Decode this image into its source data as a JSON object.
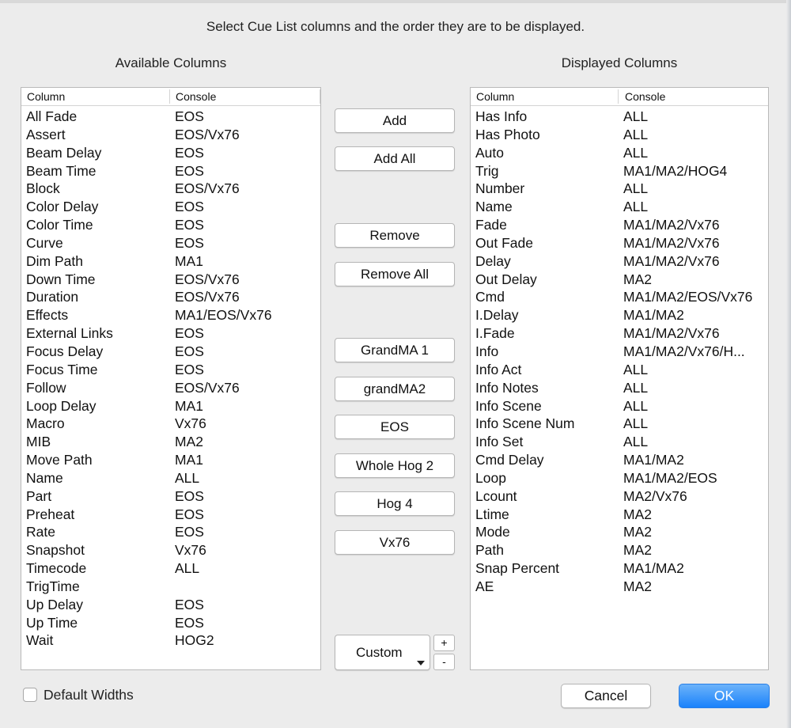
{
  "dialog": {
    "instruction": "Select Cue List columns and the order they are to be displayed."
  },
  "available": {
    "title": "Available Columns",
    "headers": [
      "Column",
      "Console"
    ],
    "rows": [
      [
        "All Fade",
        "EOS"
      ],
      [
        "Assert",
        "EOS/Vx76"
      ],
      [
        "Beam Delay",
        "EOS"
      ],
      [
        "Beam Time",
        "EOS"
      ],
      [
        "Block",
        "EOS/Vx76"
      ],
      [
        "Color Delay",
        "EOS"
      ],
      [
        "Color Time",
        "EOS"
      ],
      [
        "Curve",
        "EOS"
      ],
      [
        "Dim Path",
        "MA1"
      ],
      [
        "Down Time",
        "EOS/Vx76"
      ],
      [
        "Duration",
        "EOS/Vx76"
      ],
      [
        "Effects",
        "MA1/EOS/Vx76"
      ],
      [
        "External Links",
        "EOS"
      ],
      [
        "Focus Delay",
        "EOS"
      ],
      [
        "Focus Time",
        "EOS"
      ],
      [
        "Follow",
        "EOS/Vx76"
      ],
      [
        "Loop Delay",
        "MA1"
      ],
      [
        "Macro",
        "Vx76"
      ],
      [
        "MIB",
        "MA2"
      ],
      [
        "Move Path",
        "MA1"
      ],
      [
        "Name",
        "ALL"
      ],
      [
        "Part",
        "EOS"
      ],
      [
        "Preheat",
        "EOS"
      ],
      [
        "Rate",
        "EOS"
      ],
      [
        "Snapshot",
        "Vx76"
      ],
      [
        "Timecode",
        "ALL"
      ],
      [
        "TrigTime",
        ""
      ],
      [
        "Up Delay",
        "EOS"
      ],
      [
        "Up Time",
        "EOS"
      ],
      [
        "Wait",
        "HOG2"
      ]
    ]
  },
  "displayed": {
    "title": "Displayed Columns",
    "headers": [
      "Column",
      "Console"
    ],
    "rows": [
      [
        "Has Info",
        "ALL"
      ],
      [
        "Has Photo",
        "ALL"
      ],
      [
        "Auto",
        "ALL"
      ],
      [
        "Trig",
        "MA1/MA2/HOG4"
      ],
      [
        "Number",
        "ALL"
      ],
      [
        "Name",
        "ALL"
      ],
      [
        "Fade",
        "MA1/MA2/Vx76"
      ],
      [
        "Out Fade",
        "MA1/MA2/Vx76"
      ],
      [
        "Delay",
        "MA1/MA2/Vx76"
      ],
      [
        "Out Delay",
        "MA2"
      ],
      [
        "Cmd",
        "MA1/MA2/EOS/Vx76"
      ],
      [
        "I.Delay",
        "MA1/MA2"
      ],
      [
        "I.Fade",
        "MA1/MA2/Vx76"
      ],
      [
        "Info",
        "MA1/MA2/Vx76/H..."
      ],
      [
        "Info Act",
        "ALL"
      ],
      [
        "Info Notes",
        "ALL"
      ],
      [
        "Info Scene",
        "ALL"
      ],
      [
        "Info Scene Num",
        "ALL"
      ],
      [
        "Info Set",
        "ALL"
      ],
      [
        "Cmd Delay",
        "MA1/MA2"
      ],
      [
        "Loop",
        "MA1/MA2/EOS"
      ],
      [
        "Lcount",
        "MA2/Vx76"
      ],
      [
        "Ltime",
        "MA2"
      ],
      [
        "Mode",
        "MA2"
      ],
      [
        "Path",
        "MA2"
      ],
      [
        "Snap Percent",
        "MA1/MA2"
      ],
      [
        "AE",
        "MA2"
      ]
    ]
  },
  "buttons": {
    "add": "Add",
    "add_all": "Add All",
    "remove": "Remove",
    "remove_all": "Remove All",
    "grandma1": "GrandMA 1",
    "grandma2": "grandMA2",
    "eos": "EOS",
    "whole_hog2": "Whole Hog 2",
    "hog4": "Hog 4",
    "vx76": "Vx76",
    "custom": "Custom",
    "plus": "+",
    "minus": "-"
  },
  "footer": {
    "default_widths": "Default Widths",
    "default_widths_checked": false,
    "cancel": "Cancel",
    "ok": "OK"
  },
  "colors": {
    "accent": "#1a82fb",
    "window_bg": "#ececec"
  }
}
